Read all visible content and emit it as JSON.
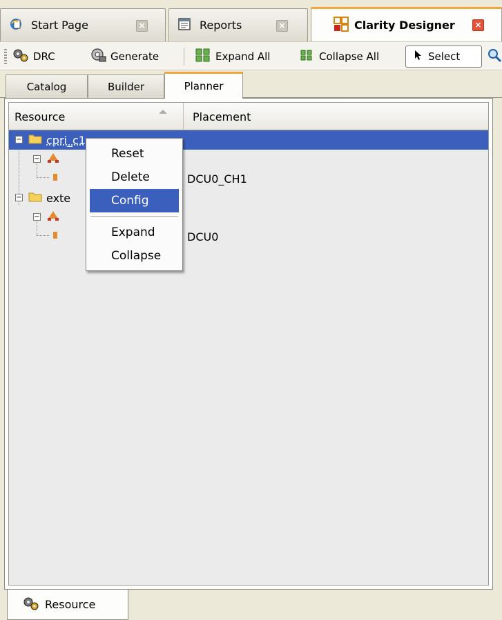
{
  "doc_tabs": [
    {
      "label": "Start Page",
      "icon": "start-page-icon"
    },
    {
      "label": "Reports",
      "icon": "reports-icon"
    },
    {
      "label": "Clarity Designer",
      "icon": "clarity-designer-icon"
    }
  ],
  "toolbar": {
    "drc_label": "DRC",
    "generate_label": "Generate",
    "expand_all_label": "Expand All",
    "collapse_all_label": "Collapse All",
    "select_label": "Select"
  },
  "view_tabs": [
    {
      "label": "Catalog"
    },
    {
      "label": "Builder"
    },
    {
      "label": "Planner"
    }
  ],
  "table": {
    "columns": [
      "Resource",
      "Placement"
    ],
    "rows": [
      {
        "resource": "cpri_c1",
        "placement": "",
        "level": 0,
        "selected": true
      },
      {
        "resource": "",
        "placement": "",
        "level": 1
      },
      {
        "resource": "",
        "placement": "DCU0_CH1",
        "level": 2
      },
      {
        "resource": "exte",
        "placement": "",
        "level": 0
      },
      {
        "resource": "",
        "placement": "",
        "level": 1
      },
      {
        "resource": "",
        "placement": "DCU0",
        "level": 2
      }
    ]
  },
  "context_menu": {
    "items": [
      "Reset",
      "Delete",
      "Config",
      "Expand",
      "Collapse"
    ],
    "highlighted": "Config"
  },
  "bottom_tab": {
    "label": "Resource"
  },
  "colors": {
    "selection": "#3b5fbd",
    "active_tab_accent": "#f2a53a",
    "close_active": "#e2533a"
  }
}
